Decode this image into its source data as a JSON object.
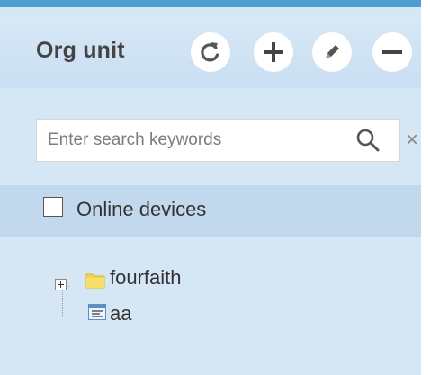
{
  "header": {
    "title": "Org unit",
    "buttons": [
      {
        "icon": "refresh-icon"
      },
      {
        "icon": "plus-icon"
      },
      {
        "icon": "pencil-icon"
      },
      {
        "icon": "minus-icon"
      }
    ]
  },
  "search": {
    "placeholder": "Enter search keywords",
    "value": "",
    "search_icon": "magnifier-icon",
    "clear_icon": "close-icon",
    "clear_label": "×"
  },
  "filter": {
    "online_devices_label": "Online devices",
    "checked": false
  },
  "tree": {
    "nodes": [
      {
        "label": "fourfaith",
        "icon": "folder-icon",
        "expander": "plus"
      },
      {
        "label": "aa",
        "icon": "device-icon"
      }
    ]
  },
  "colors": {
    "top_bar": "#4a9fd0",
    "panel_bg": "#d5e6f5",
    "row_highlight": "#c2d9ed",
    "folder": "#f5d44a"
  }
}
